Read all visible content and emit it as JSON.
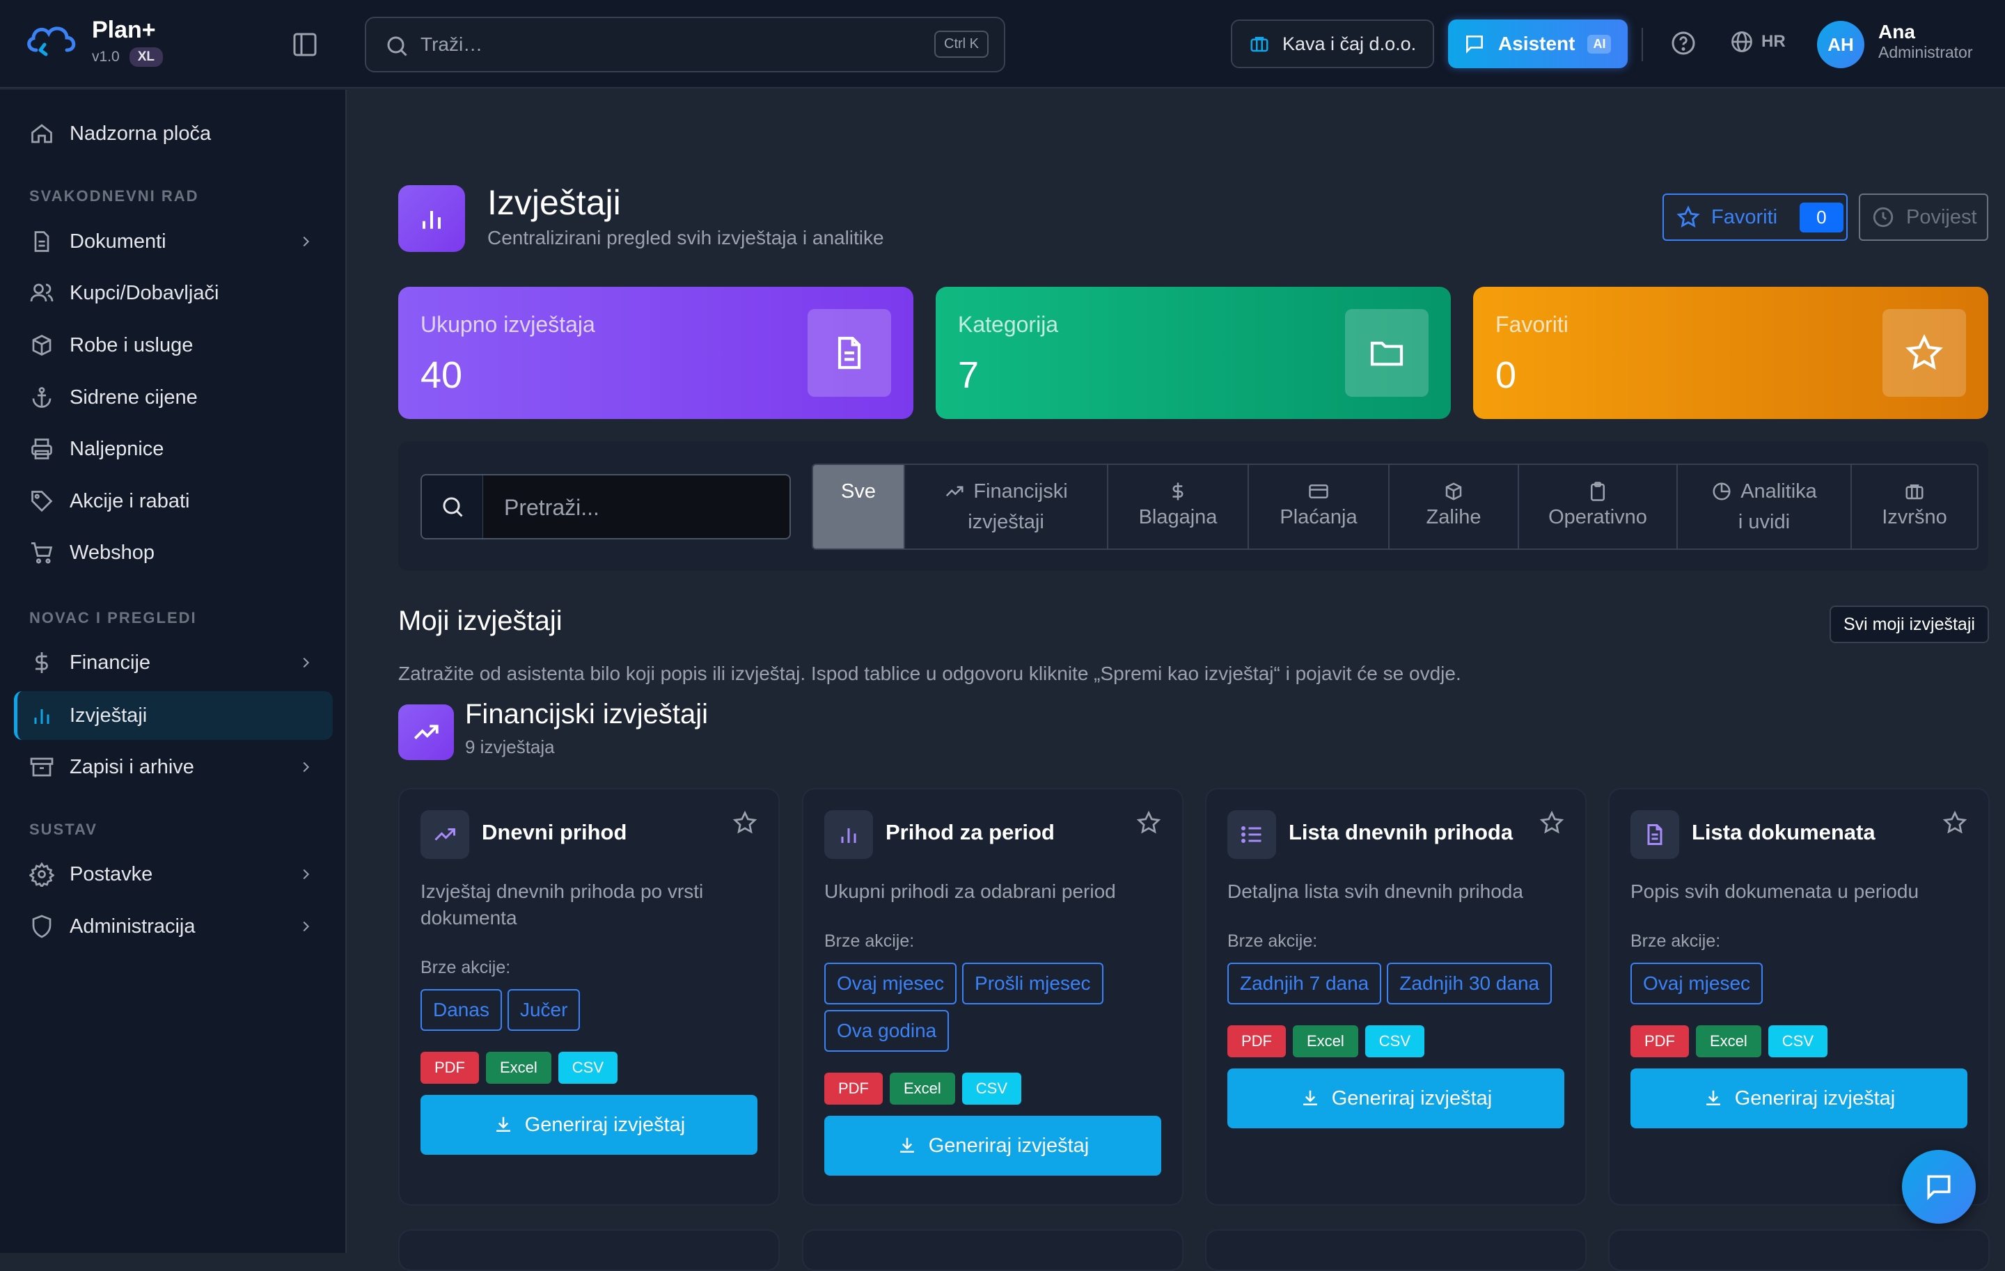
{
  "app": {
    "name": "Plan+",
    "version": "v1.0",
    "badge": "XL"
  },
  "search": {
    "placeholder": "Traži…",
    "shortcut": "Ctrl K"
  },
  "header": {
    "company": "Kava i čaj d.o.o.",
    "assistant_label": "Asistent",
    "assistant_badge": "AI",
    "language": "HR"
  },
  "user": {
    "initials": "AH",
    "name": "Ana",
    "role": "Administrator"
  },
  "sidebar": {
    "top_item": "Nadzorna ploča",
    "sections": [
      {
        "title": "SVAKODNEVNI RAD",
        "items": [
          "Dokumenti",
          "Kupci/Dobavljači",
          "Robe i usluge",
          "Sidrene cijene",
          "Naljepnice",
          "Akcije i rabati",
          "Webshop"
        ]
      },
      {
        "title": "NOVAC I PREGLEDI",
        "items": [
          "Financije",
          "Izvještaji",
          "Zapisi i arhive"
        ]
      },
      {
        "title": "SUSTAV",
        "items": [
          "Postavke",
          "Administracija"
        ]
      }
    ],
    "active": "Izvještaji"
  },
  "page": {
    "title": "Izvještaji",
    "subtitle": "Centralizirani pregled svih izvještaja i analitike",
    "favorites_label": "Favoriti",
    "favorites_count": "0",
    "history_label": "Povijest"
  },
  "stats": [
    {
      "label": "Ukupno izvještaja",
      "value": "40",
      "icon": "document-icon",
      "color": "#8b5cf6"
    },
    {
      "label": "Kategorija",
      "value": "7",
      "icon": "folder-icon",
      "color": "#10b981"
    },
    {
      "label": "Favoriti",
      "value": "0",
      "icon": "star-icon",
      "color": "#f59e0b"
    }
  ],
  "filter": {
    "search_placeholder": "Pretraži...",
    "tabs": [
      {
        "label": "Sve",
        "icon": ""
      },
      {
        "label1": "Financijski",
        "label2": "izvještaji",
        "icon": "trend-icon"
      },
      {
        "label": "Blagajna",
        "icon": "dollar-icon"
      },
      {
        "label": "Plaćanja",
        "icon": "card-icon"
      },
      {
        "label": "Zalihe",
        "icon": "box-icon"
      },
      {
        "label": "Operativno",
        "icon": "clipboard-icon"
      },
      {
        "label1": "Analitika",
        "label2": "i uvidi",
        "icon": "pie-icon"
      },
      {
        "label": "Izvršno",
        "icon": "briefcase-icon"
      }
    ]
  },
  "my_reports": {
    "title": "Moji izvještaji",
    "all_button": "Svi moji izvještaji",
    "hint": "Zatražite od asistenta bilo koji popis ili izvještaj. Ispod tablice u odgovoru kliknite „Spremi kao izvještaj“ i pojavit će se ovdje."
  },
  "category": {
    "title": "Financijski izvještaji",
    "count": "9 izvještaja"
  },
  "cards": [
    {
      "title": "Dnevni prihod",
      "icon": "trend-icon",
      "desc": "Izvještaj dnevnih prihoda po vrsti dokumenta",
      "quick_label": "Brze akcije:",
      "quick": [
        "Danas",
        "Jučer"
      ]
    },
    {
      "title": "Prihod za period",
      "icon": "bar-chart-icon",
      "desc": "Ukupni prihodi za odabrani period",
      "quick_label": "Brze akcije:",
      "quick": [
        "Ovaj mjesec",
        "Prošli mjesec",
        "Ova godina"
      ]
    },
    {
      "title": "Lista dnevnih prihoda",
      "icon": "list-icon",
      "desc": "Detaljna lista svih dnevnih prihoda",
      "quick_label": "Brze akcije:",
      "quick": [
        "Zadnjih 7 dana",
        "Zadnjih 30 dana"
      ]
    },
    {
      "title": "Lista dokumenata",
      "icon": "document-icon",
      "desc": "Popis svih dokumenata u periodu",
      "quick_label": "Brze akcije:",
      "quick": [
        "Ovaj mjesec"
      ]
    }
  ],
  "formats": [
    "PDF",
    "Excel",
    "CSV"
  ],
  "generate_label": "Generiraj izvještaj"
}
